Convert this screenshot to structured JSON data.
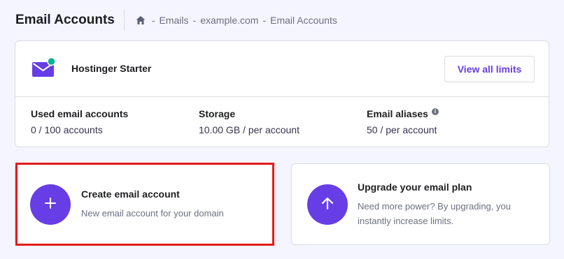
{
  "header": {
    "title": "Email Accounts",
    "breadcrumb": {
      "home_icon": "home-icon",
      "items": [
        "Emails",
        "example.com",
        "Email Accounts"
      ],
      "separator": "-"
    }
  },
  "plan": {
    "icon": "mail-icon",
    "name": "Hostinger Starter",
    "view_limits_label": "View all limits",
    "stats": [
      {
        "label": "Used email accounts",
        "value": "0 / 100 accounts"
      },
      {
        "label": "Storage",
        "value": "10.00 GB / per account"
      },
      {
        "label": "Email aliases",
        "value": "50 / per account",
        "info_icon": "info-icon"
      }
    ]
  },
  "actions": {
    "create": {
      "icon": "plus-icon",
      "title": "Create email account",
      "description": "New email account for your domain"
    },
    "upgrade": {
      "icon": "arrow-up-icon",
      "title": "Upgrade your email plan",
      "description": "Need more power? By upgrading, you instantly increase limits."
    }
  },
  "colors": {
    "accent": "#673de6",
    "highlight": "#e21b1b",
    "status_dot": "#00b090",
    "background": "#f4f5ff"
  }
}
